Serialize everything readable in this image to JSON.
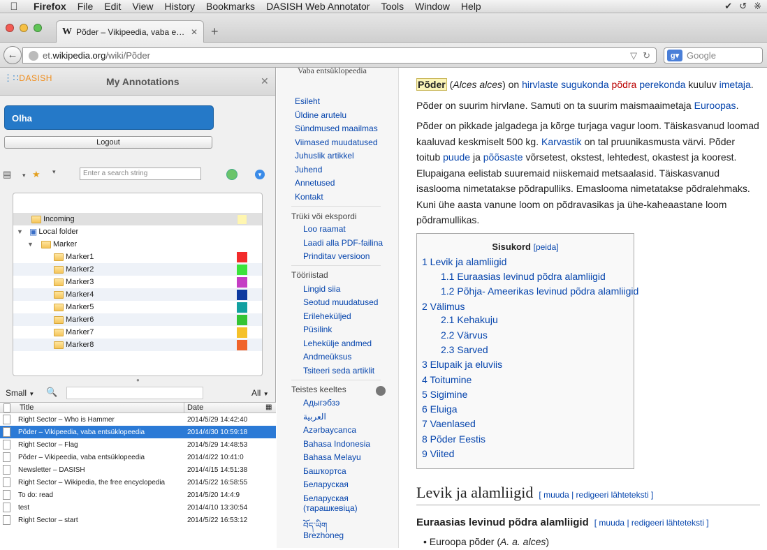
{
  "menubar": {
    "app": "Firefox",
    "items": [
      "File",
      "Edit",
      "View",
      "History",
      "Bookmarks",
      "DASISH Web Annotator",
      "Tools",
      "Window",
      "Help"
    ]
  },
  "tab": {
    "title": "Põder – Vikipeedia, vaba e…"
  },
  "url": {
    "pre": "et.",
    "domain": "wikipedia.org",
    "path": "/wiki/Põder"
  },
  "search": {
    "placeholder": "Google"
  },
  "sidebar": {
    "logo": "DASISH",
    "title": "My Annotations",
    "user": "Olha",
    "logout": "Logout",
    "search_placeholder": "Enter a search string",
    "seg": {
      "custom": "Custom",
      "date": "Date"
    },
    "tree": {
      "incoming": "Incoming",
      "local": "Local folder",
      "marker": "Marker",
      "markers": [
        {
          "name": "Marker1",
          "color": "#f22b2b"
        },
        {
          "name": "Marker2",
          "color": "#3be33b"
        },
        {
          "name": "Marker3",
          "color": "#c43dc4"
        },
        {
          "name": "Marker4",
          "color": "#0d3aa0"
        },
        {
          "name": "Marker5",
          "color": "#12a0a0"
        },
        {
          "name": "Marker6",
          "color": "#34c434"
        },
        {
          "name": "Marker7",
          "color": "#f5c12a"
        },
        {
          "name": "Marker8",
          "color": "#f0642a"
        }
      ],
      "incoming_color": "#fff6b0"
    },
    "list_controls": {
      "size": "Small",
      "filter": "All"
    },
    "list_headers": {
      "title": "Title",
      "date": "Date"
    },
    "annotations": [
      {
        "title": "Right Sector – Who is Hammer",
        "date": "2014/5/29 14:42:40"
      },
      {
        "title": "Põder – Vikipeedia, vaba entsüklopeedia",
        "date": "2014/4/30 10:59:18"
      },
      {
        "title": "Right Sector – Flag",
        "date": "2014/5/29 14:48:53"
      },
      {
        "title": "Põder – Vikipeedia, vaba entsüklopeedia",
        "date": "2014/4/22 10:41:0"
      },
      {
        "title": "Newsletter – DASISH",
        "date": "2014/4/15 14:51:38"
      },
      {
        "title": "Right Sector – Wikipedia, the free encyclopedia",
        "date": "2014/5/22 16:58:55"
      },
      {
        "title": "To do: read",
        "date": "2014/5/20 14:4:9"
      },
      {
        "title": "test",
        "date": "2014/4/10 13:30:54"
      },
      {
        "title": "Right Sector – start",
        "date": "2014/5/22 16:53:12"
      }
    ]
  },
  "wikinav": {
    "tagline": "Vaba entsüklopeedia",
    "main": [
      "Esileht",
      "Üldine arutelu",
      "Sündmused maailmas",
      "Viimased muudatused",
      "Juhuslik artikkel",
      "Juhend",
      "Annetused",
      "Kontakt"
    ],
    "print_h": "Trüki või ekspordi",
    "print": [
      "Loo raamat",
      "Laadi alla PDF-failina",
      "Prinditav versioon"
    ],
    "tools_h": "Tööriistad",
    "tools": [
      "Lingid siia",
      "Seotud muudatused",
      "Erileheküljed",
      "Püsilink",
      "Lehekülje andmed",
      "Andmeüksus",
      "Tsiteeri seda artiklit"
    ],
    "lang_h": "Teistes keeltes",
    "langs": [
      "Адыгэбзэ",
      "العربية",
      "Azərbaycanca",
      "Bahasa Indonesia",
      "Bahasa Melayu",
      "Башҡортса",
      "Беларуская",
      "Беларуская",
      "(тарашкевіца)",
      "བོད་ཡིག",
      "Brezhoneg"
    ]
  },
  "article": {
    "p1": {
      "w1": "Põder",
      "w2": "Alces alces",
      "w3": " on ",
      "l1": "hirvlaste",
      "l2": "sugukonda",
      "l3": "põdra",
      "l4": "perekonda",
      "w4": " kuuluv ",
      "l5": "imetaja",
      "w5": "."
    },
    "p2": {
      "t": "Põder on suurim hirvlane. Samuti on ta suurim maismaaimetaja ",
      "l": "Euroopas",
      "e": "."
    },
    "p3": {
      "t1": "Põder on pikkade jalgadega ja kõrge turjaga vagur loom. Täiskasvanud loomad kaaluvad keskmiselt 500 kg. ",
      "l1": "Karvastik",
      "t2": " on tal pruunikasmusta värvi. Põder toitub ",
      "l2": "puude",
      "t3": " ja ",
      "l3": "põõsaste",
      "t4": " võrsetest, okstest, lehtedest, okastest ja koorest. Elupaigana eelistab suuremaid niiskemaid metsaalasid. Täiskasvanud isasloomа nimetatakse põdrapulliks. Emasloomа nimetatakse põdralehmaks. Kuni ühe aasta vanune loom on põdravasikas ja ühe-kaheaastane loom põdramullikas."
    },
    "toc": {
      "title": "Sisukord",
      "edit": "[peida]",
      "items": [
        "1 Levik ja alamliigid",
        "1.1 Euraasias levinud põdra alamliigid",
        "1.2 Põhja- Ameerikas levinud põdra alamliigid",
        "2 Välimus",
        "2.1 Kehakuju",
        "2.2 Värvus",
        "2.3 Sarved",
        "3 Elupaik ja eluviis",
        "4 Toitumine",
        "5 Sigimine",
        "6 Eluiga",
        "7 Vaenlased",
        "8 Põder Eestis",
        "9 Viited"
      ]
    },
    "h2": "Levik ja alamliigid",
    "h2_edit": "[ muuda | redigeeri lähteteksti ]",
    "h3": "Euraasias levinud põdra alamliigid",
    "h3_edit": "[ muuda | redigeeri lähteteksti ]",
    "bullet": {
      "a": "Euroopa põder (",
      "b": "A. a. alces",
      "c": ")"
    }
  }
}
